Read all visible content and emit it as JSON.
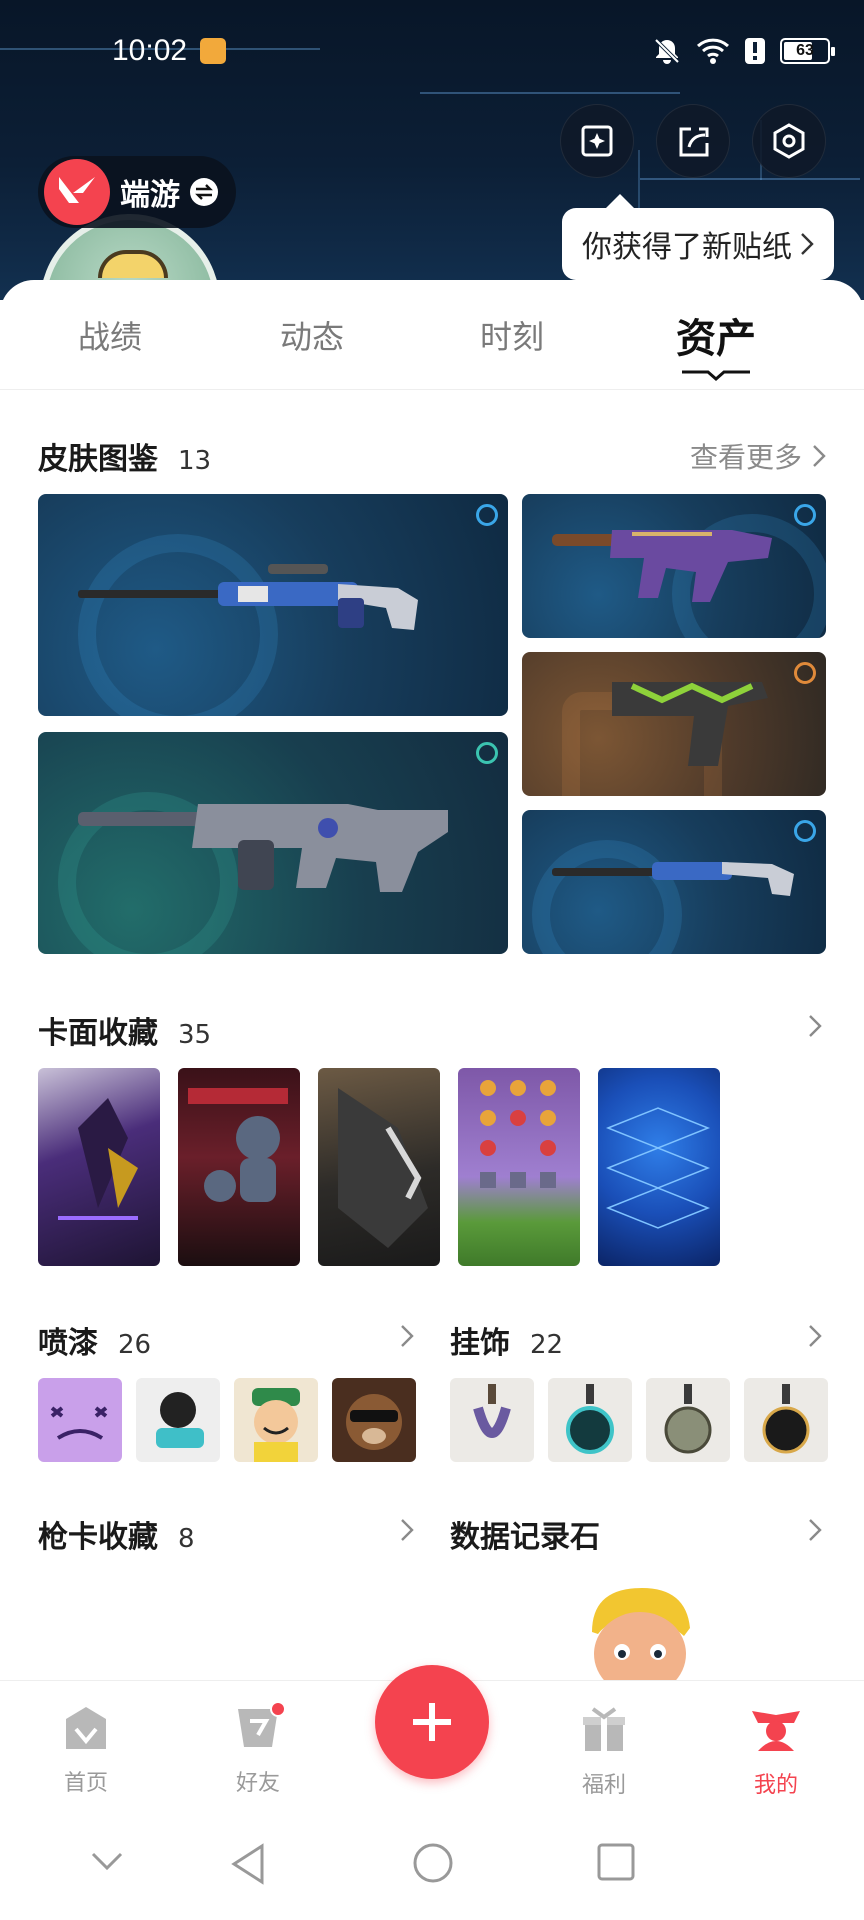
{
  "status_bar": {
    "time": "10:02",
    "battery": "63"
  },
  "header": {
    "game_name": "端游",
    "sticker_tip": "你获得了新贴纸"
  },
  "tabs": [
    {
      "label": "战绩",
      "active": false
    },
    {
      "label": "动态",
      "active": false
    },
    {
      "label": "时刻",
      "active": false
    },
    {
      "label": "资产",
      "active": true
    }
  ],
  "skins": {
    "title": "皮肤图鉴",
    "count": "13",
    "more_label": "查看更多"
  },
  "cards": {
    "title": "卡面收藏",
    "count": "35"
  },
  "sprays": {
    "title": "喷漆",
    "count": "26"
  },
  "charms": {
    "title": "挂饰",
    "count": "22"
  },
  "gun_cards": {
    "title": "枪卡收藏",
    "count": "8"
  },
  "data_stone": {
    "title": "数据记录石"
  },
  "bottom_nav": [
    {
      "label": "首页",
      "icon": "home-icon",
      "active": false
    },
    {
      "label": "好友",
      "icon": "friends-icon",
      "active": false,
      "badge": true
    },
    {
      "label": "",
      "icon": "plus-icon",
      "active": false
    },
    {
      "label": "福利",
      "icon": "gift-icon",
      "active": false
    },
    {
      "label": "我的",
      "icon": "profile-icon",
      "active": true
    }
  ],
  "colors": {
    "accent": "#f4434f",
    "header_bg": "#0c1f36"
  }
}
